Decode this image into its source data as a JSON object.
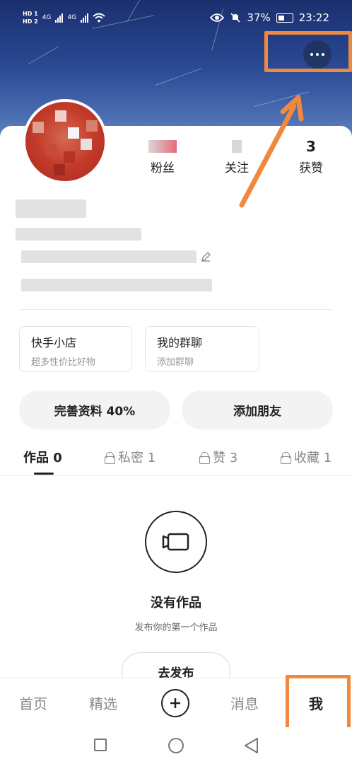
{
  "status_bar": {
    "hd1": "HD 1",
    "hd2": "HD 2",
    "net1": "4G",
    "net2": "4G",
    "battery": "37%",
    "time": "23:22"
  },
  "profile": {
    "stats": [
      {
        "label": "粉丝"
      },
      {
        "label": "关注"
      },
      {
        "label": "获赞",
        "value": "3"
      }
    ]
  },
  "shortcuts": [
    {
      "title": "快手小店",
      "subtitle": "超多性价比好物"
    },
    {
      "title": "我的群聊",
      "subtitle": "添加群聊"
    }
  ],
  "actions": {
    "complete_profile": "完善资料 40%",
    "add_friends": "添加朋友"
  },
  "tabs": [
    {
      "label": "作品 0"
    },
    {
      "label": "私密 1"
    },
    {
      "label": "赞 3"
    },
    {
      "label": "收藏 1"
    }
  ],
  "empty_state": {
    "title": "没有作品",
    "subtitle": "发布你的第一个作品",
    "button": "去发布"
  },
  "bottom_nav": {
    "home": "首页",
    "featured": "精选",
    "messages": "消息",
    "me": "我"
  },
  "colors": {
    "highlight": "#f0883e",
    "header": "#2a4a94"
  }
}
